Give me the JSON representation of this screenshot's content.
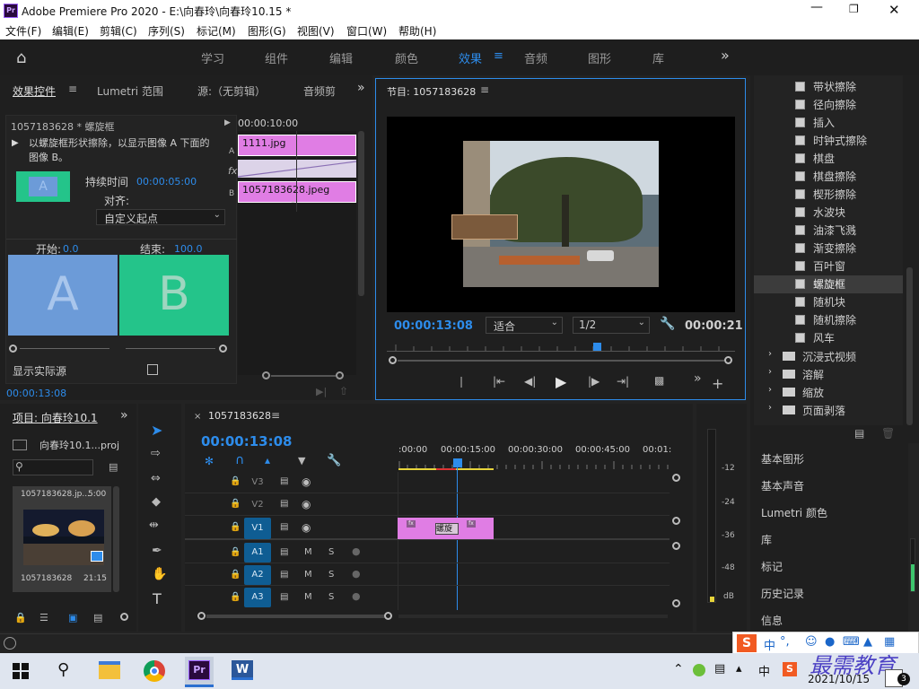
{
  "window": {
    "title": "Adobe Premiere Pro 2020 - E:\\向春玲\\向春玲10.15 *",
    "app_icon": "Pr"
  },
  "menu": [
    "文件(F)",
    "编辑(E)",
    "剪辑(C)",
    "序列(S)",
    "标记(M)",
    "图形(G)",
    "视图(V)",
    "窗口(W)",
    "帮助(H)"
  ],
  "workspaces": {
    "tabs": [
      "学习",
      "组件",
      "编辑",
      "颜色",
      "效果",
      "音频",
      "图形",
      "库"
    ],
    "active": "效果",
    "more": "»"
  },
  "effect_controls": {
    "tabs": [
      "效果控件",
      "Lumetri 范围",
      "源:（无剪辑）",
      "音频剪"
    ],
    "clip_name": "1057183628 * 螺旋框",
    "description": "以螺旋框形状擦除，以显示图像 A 下面的图像 B。",
    "duration_label": "持续时间",
    "duration": "00:00:05:00",
    "align_label": "对齐:",
    "align_value": "自定义起点",
    "start_label": "开始:",
    "start_value": "0.0",
    "end_label": "结束:",
    "end_value": "100.0",
    "a_label": "A",
    "b_label": "B",
    "show_source": "显示实际源",
    "timecode": "00:00:10:00",
    "clip_a": "1111.jpg",
    "clip_b": "1057183628.jpeg",
    "row_a": "A",
    "row_b": "B",
    "fx": "fx",
    "bottom_tc": "00:00:13:08"
  },
  "program": {
    "title": "节目: 1057183628",
    "timecode": "00:00:13:08",
    "fit": "适合",
    "res": "1/2",
    "duration": "00:00:21"
  },
  "project": {
    "title": "项目: 向春玲10.1",
    "file": "向春玲10.1...proj",
    "thumb_top": "1057183628.jp...",
    "thumb_top_dur": "5:00",
    "thumb_name": "1057183628",
    "thumb_dur": "21:15"
  },
  "timeline": {
    "title": "1057183628",
    "timecode": "00:00:13:08",
    "ruler": [
      ":00:00",
      "00:00:15:00",
      "00:00:30:00",
      "00:00:45:00",
      "00:01:0"
    ],
    "tracks": [
      "V3",
      "V2",
      "V1",
      "A1",
      "A2",
      "A3"
    ],
    "transition_label": "螺旋"
  },
  "meter_scale": [
    "-12",
    "-24",
    "-36",
    "-48",
    "dB"
  ],
  "effects_list": {
    "items": [
      "带状擦除",
      "径向擦除",
      "插入",
      "时钟式擦除",
      "棋盘",
      "棋盘擦除",
      "楔形擦除",
      "水波块",
      "油漆飞溅",
      "渐变擦除",
      "百叶窗",
      "螺旋框",
      "随机块",
      "随机擦除",
      "风车"
    ],
    "selected": "螺旋框",
    "folders": [
      "沉浸式视频",
      "溶解",
      "缩放",
      "页面剥落"
    ]
  },
  "right_panels": [
    "基本图形",
    "基本声音",
    "Lumetri 颜色",
    "库",
    "标记",
    "历史记录",
    "信息"
  ],
  "ime": {
    "mode": "中",
    "symbols": "°,"
  },
  "watermark": "最需教育",
  "tray": {
    "time": "",
    "date": "2021/10/15",
    "lang": "中",
    "badge": "3"
  }
}
